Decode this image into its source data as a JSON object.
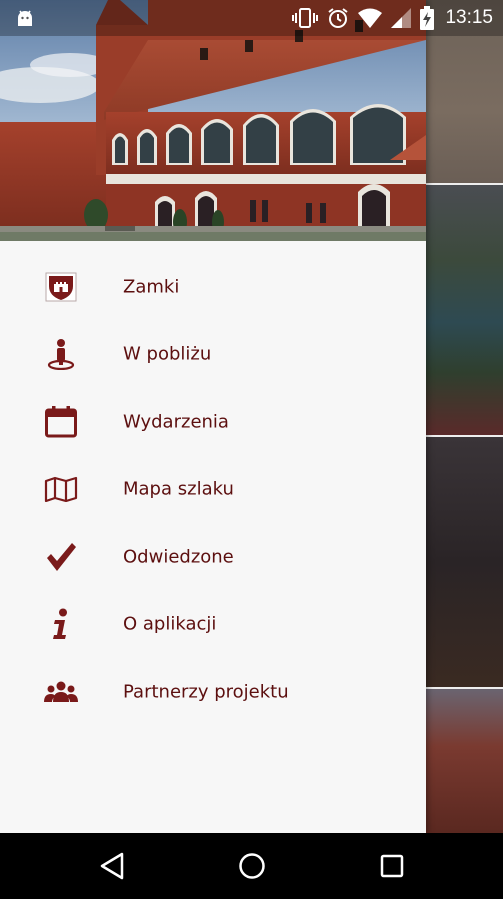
{
  "status_bar": {
    "time": "13:15",
    "icons": [
      "android-debug-icon",
      "vibrate-icon",
      "alarm-icon",
      "wifi-icon",
      "cell-signal-icon",
      "battery-charging-icon"
    ]
  },
  "drawer": {
    "header_image": "castle-photo",
    "accent_color": "#7a1a1a",
    "items": [
      {
        "icon": "castle-shield-icon",
        "label": "Zamki"
      },
      {
        "icon": "person-pin-icon",
        "label": "W pobliżu"
      },
      {
        "icon": "calendar-icon",
        "label": "Wydarzenia"
      },
      {
        "icon": "map-icon",
        "label": "Mapa szlaku"
      },
      {
        "icon": "checkmark-icon",
        "label": "Odwiedzone"
      },
      {
        "icon": "info-icon",
        "label": "O aplikacji"
      },
      {
        "icon": "group-icon",
        "label": "Partnerzy projektu"
      }
    ]
  },
  "nav_bar": {
    "buttons": [
      "back-icon",
      "home-icon",
      "recents-icon"
    ]
  }
}
